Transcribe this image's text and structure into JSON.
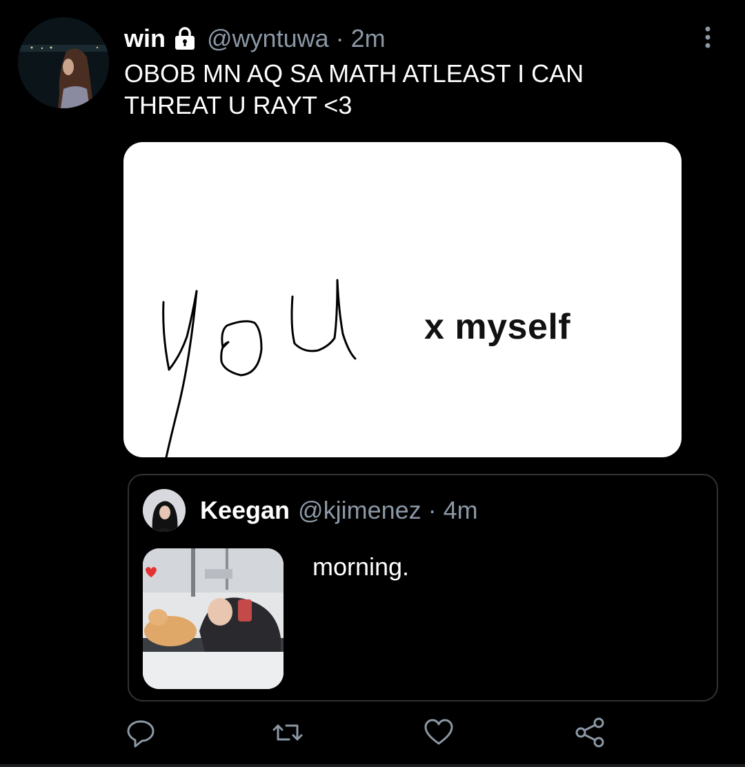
{
  "tweet": {
    "name": "win",
    "handle": "@wyntuwa",
    "separator": "·",
    "time": "2m",
    "text": "OBOB MN AQ SA MATH ATLEAST I CAN THREAT U RAYT <3",
    "media": {
      "handwritten_word": "you",
      "printed_text": "x myself"
    }
  },
  "quote": {
    "name": "Keegan",
    "handle": "@kjimenez",
    "separator": "·",
    "time": "4m",
    "text": "morning."
  },
  "icons": {
    "lock": "lock-icon",
    "more": "more-vertical-icon",
    "reply": "reply-icon",
    "retweet": "retweet-icon",
    "like": "heart-icon",
    "share": "share-icon"
  },
  "colors": {
    "background": "#000000",
    "secondary_text": "#8b98a5",
    "border": "#2f3336"
  }
}
